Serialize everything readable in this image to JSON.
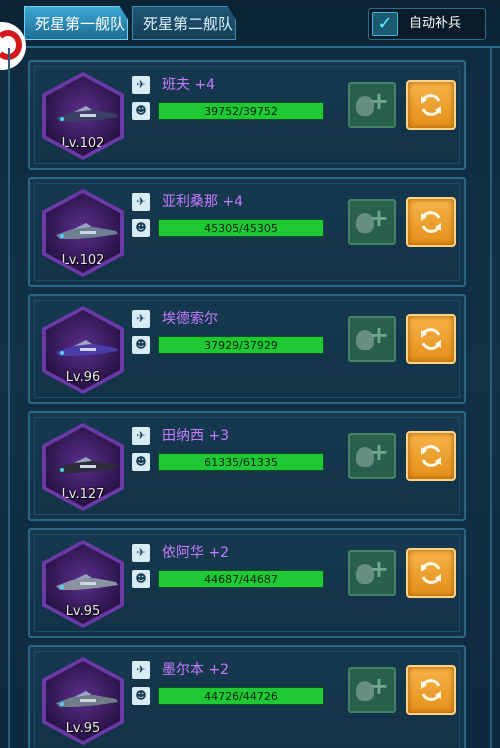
{
  "tabs": [
    {
      "label": "死星第一舰队",
      "active": true
    },
    {
      "label": "死星第二舰队",
      "active": false
    }
  ],
  "auto_replenish": {
    "label": "自动补兵",
    "checked": true
  },
  "ships": [
    {
      "name": "班夫 +4",
      "level": "Lv.102",
      "hp_text": "39752/39752",
      "hp_fraction": 1.0,
      "type_icon": "fighter-icon",
      "hull_color": "#3b3f66"
    },
    {
      "name": "亚利桑那 +4",
      "level": "Lv.102",
      "hp_text": "45305/45305",
      "hp_fraction": 1.0,
      "type_icon": "destroyer-icon",
      "hull_color": "#6e7f93"
    },
    {
      "name": "埃德索尔",
      "level": "Lv.96",
      "hp_text": "37929/37929",
      "hp_fraction": 1.0,
      "type_icon": "frigate-icon",
      "hull_color": "#4a3da8"
    },
    {
      "name": "田纳西 +3",
      "level": "Lv.127",
      "hp_text": "61335/61335",
      "hp_fraction": 1.0,
      "type_icon": "cruiser-icon",
      "hull_color": "#2e2b3a"
    },
    {
      "name": "依阿华 +2",
      "level": "Lv.95",
      "hp_text": "44687/44687",
      "hp_fraction": 1.0,
      "type_icon": "cruiser-icon",
      "hull_color": "#8a92a0"
    },
    {
      "name": "墨尔本 +2",
      "level": "Lv.95",
      "hp_text": "44726/44726",
      "hp_fraction": 1.0,
      "type_icon": "carrier-icon",
      "hull_color": "#6f7e86"
    }
  ]
}
